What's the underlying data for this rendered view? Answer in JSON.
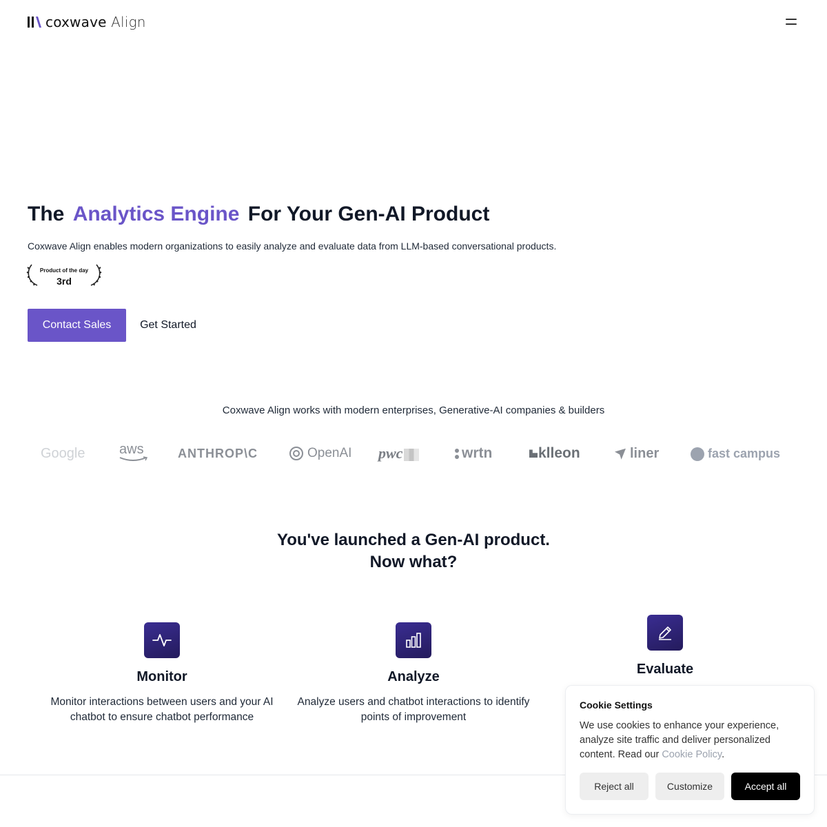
{
  "header": {
    "brand": "coxwave",
    "product": "Align",
    "menu_icon": "hamburger-icon"
  },
  "hero": {
    "title_prefix": "The",
    "title_accent": "Analytics Engine",
    "title_suffix": "For Your Gen-AI Product",
    "subtitle": "Coxwave Align enables modern organizations to easily analyze and evaluate data from LLM-based conversational products.",
    "badge_line1": "Product of the day",
    "badge_line2": "3rd",
    "primary_cta": "Contact Sales",
    "secondary_cta": "Get Started",
    "accent_color": "#6a55c8"
  },
  "partners": {
    "caption": "Coxwave Align works with modern enterprises, Generative-AI companies & builders",
    "logos": [
      "Google",
      "aws",
      "ANTHROP\\C",
      "OpenAI",
      "pwc",
      "wrtn",
      "klleon",
      "liner",
      "fast campus"
    ]
  },
  "section": {
    "title_line1": "You've launched a Gen-AI product.",
    "title_line2": "Now what?"
  },
  "features": [
    {
      "icon": "activity-icon",
      "title": "Monitor",
      "desc": "Monitor interactions between users and your AI chatbot to ensure chatbot performance"
    },
    {
      "icon": "bar-chart-icon",
      "title": "Analyze",
      "desc": "Analyze users and chatbot interactions to identify points of improvement"
    },
    {
      "icon": "pencil-icon",
      "title": "Evaluate",
      "desc": ""
    }
  ],
  "cookie": {
    "title": "Cookie Settings",
    "text": "We use cookies to enhance your experience, analyze site traffic and deliver personalized content. Read our ",
    "link": "Cookie Policy",
    "period": ".",
    "reject": "Reject all",
    "customize": "Customize",
    "accept": "Accept all"
  }
}
